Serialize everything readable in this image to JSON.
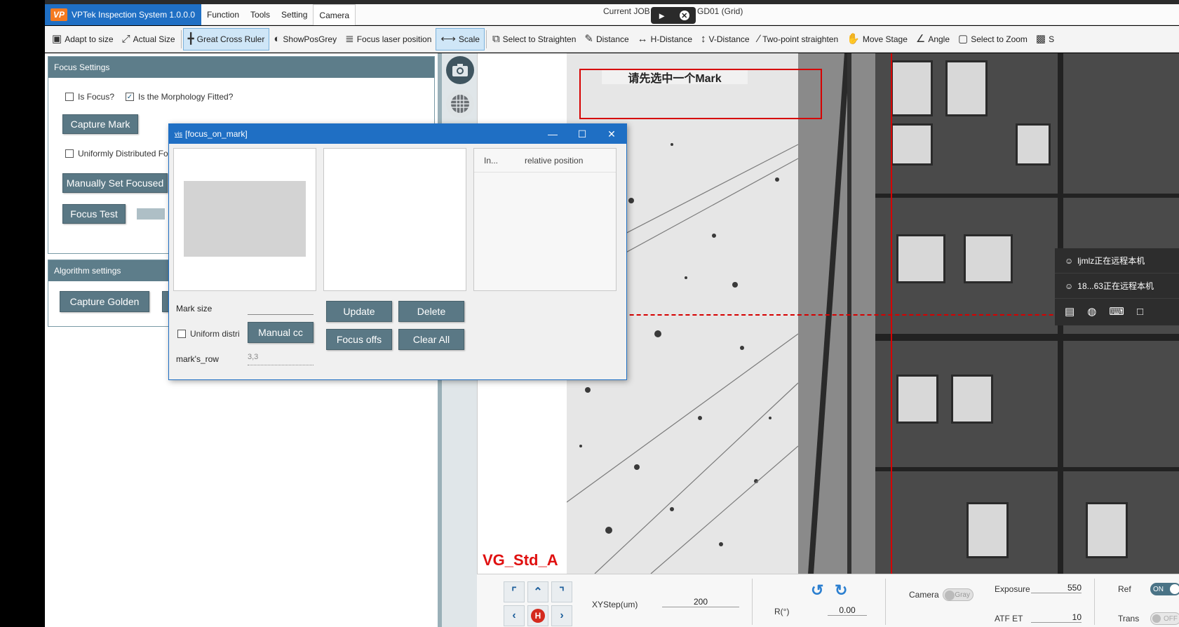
{
  "app": {
    "title": "VPTek Inspection System 1.0.0.0",
    "logo_text": "VP",
    "menu": [
      "Function",
      "Tools",
      "Setting",
      "Camera"
    ],
    "job_label": "Current JOB",
    "job_suffix": "GD01 (Grid)"
  },
  "toolbar": {
    "items": [
      {
        "label": "Adapt to size",
        "icon": "fit-icon"
      },
      {
        "label": "Actual Size",
        "icon": "actual-size-icon"
      },
      {
        "label": "Great Cross Ruler",
        "icon": "cross-ruler-icon",
        "active": true
      },
      {
        "label": "ShowPosGrey",
        "icon": "contrast-icon"
      },
      {
        "label": "Focus laser position",
        "icon": "laser-icon"
      },
      {
        "label": "Scale",
        "icon": "scale-icon",
        "active": true
      },
      {
        "label": "Select to Straighten",
        "icon": "crop-rotate-icon"
      },
      {
        "label": "Distance",
        "icon": "ruler-icon"
      },
      {
        "label": "H-Distance",
        "icon": "h-distance-icon"
      },
      {
        "label": "V-Distance",
        "icon": "v-distance-icon"
      },
      {
        "label": "Two-point straighten",
        "icon": "two-point-icon"
      },
      {
        "label": "Move Stage",
        "icon": "hand-icon"
      },
      {
        "label": "Angle",
        "icon": "angle-icon"
      },
      {
        "label": "Select to Zoom",
        "icon": "zoom-select-icon"
      },
      {
        "label": "S",
        "icon": "image-icon"
      }
    ]
  },
  "focus_settings": {
    "header": "Focus Settings",
    "is_focus_label": "Is Focus?",
    "morphology_label": "Is the Morphology Fitted?",
    "capture_mark": "Capture Mark",
    "uniform_label": "Uniformly Distributed Fo",
    "manual_focused": "Manually Set Focused",
    "focus_test": "Focus Test"
  },
  "algorithm_settings": {
    "header": "Algorithm settings",
    "capture_golden": "Capture Golden"
  },
  "camera_view": {
    "overlay_message": "请先选中一个Mark",
    "recipe_label": "VG_Std_A"
  },
  "remote_session": {
    "line1": "ljmlz正在远程本机",
    "line2": "18...63正在远程本机"
  },
  "dialog": {
    "title": "[focus_on_mark]",
    "logo": "vis",
    "table_col1": "In...",
    "table_col2": "relative position",
    "mark_size_label": "Mark size",
    "mark_size_value": "",
    "uniform_label": "Uniform distri",
    "manual_btn": "Manual cc",
    "marks_row_label": "mark's_row",
    "marks_row_placeholder": "3,3",
    "update": "Update",
    "delete": "Delete",
    "focus_offs": "Focus offs",
    "clear_all": "Clear All"
  },
  "bottom": {
    "xystep_label": "XYStep(um)",
    "xystep_value": "200",
    "r_label": "R(°)",
    "r_value": "0.00",
    "camera_label": "Camera",
    "camera_toggle": "Gray",
    "exposure_label": "Exposure",
    "exposure_value": "550",
    "atf_label": "ATF ET",
    "atf_value": "10",
    "ref_label": "Ref",
    "ref_toggle": "ON",
    "trans_label": "Trans",
    "trans_toggle": "OFF"
  },
  "colors": {
    "accent": "#1f6fc4",
    "slate": "#5a7885",
    "overlay_red": "#d60000"
  }
}
